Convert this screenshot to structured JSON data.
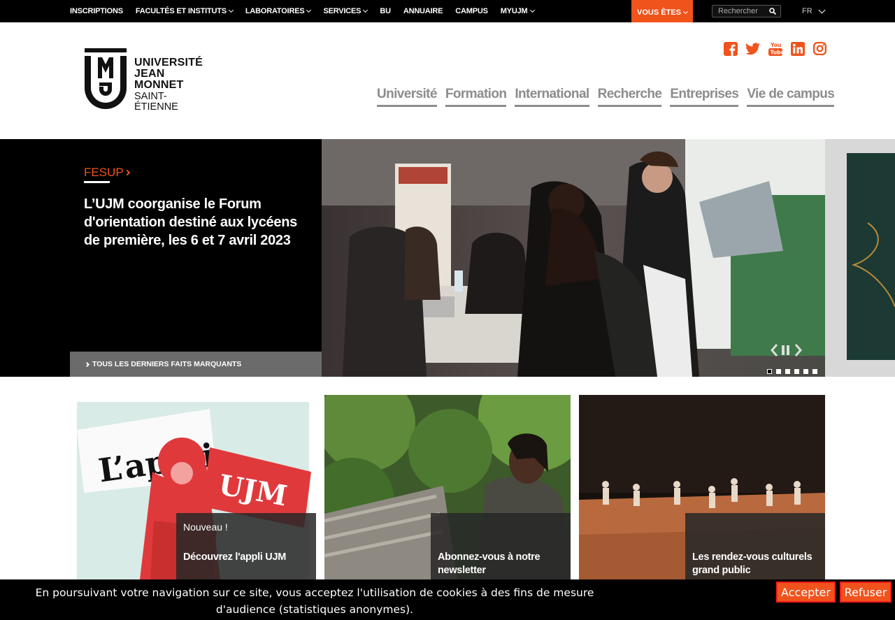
{
  "topbar": {
    "items": [
      {
        "label": "INSCRIPTIONS",
        "dropdown": false
      },
      {
        "label": "FACULTÉS ET INSTITUTS",
        "dropdown": true
      },
      {
        "label": "LABORATOIRES",
        "dropdown": true
      },
      {
        "label": "SERVICES",
        "dropdown": true
      },
      {
        "label": "BU",
        "dropdown": false
      },
      {
        "label": "ANNUAIRE",
        "dropdown": false
      },
      {
        "label": "CAMPUS",
        "dropdown": false
      },
      {
        "label": "MYUJM",
        "dropdown": true
      }
    ],
    "vous_etes": "VOUS ÊTES",
    "search_placeholder": "Rechercher",
    "language": "FR"
  },
  "logo": {
    "line1": "UNIVERSITÉ",
    "line2": "JEAN MONNET",
    "line3": "SAINT-ÉTIENNE"
  },
  "social_icons": [
    "facebook-icon",
    "twitter-icon",
    "youtube-icon",
    "linkedin-icon",
    "instagram-icon"
  ],
  "mainnav": [
    "Université",
    "Formation",
    "International",
    "Recherche",
    "Entreprises",
    "Vie de campus"
  ],
  "hero": {
    "category": "FESUP",
    "title": "L’UJM coorganise le Forum d'orientation destiné aux lycéens de première, les 6 et 7 avril 2023",
    "all_link": "TOUS LES DERNIERS FAITS MARQUANTS",
    "slide_count": 6,
    "active_slide": 0
  },
  "tiles": [
    {
      "kicker": "Nouveau !",
      "title": "Découvrez l'appli UJM",
      "image_text_1": "L’appli",
      "image_text_2": "UJM"
    },
    {
      "kicker": "",
      "title": "Abonnez-vous à notre newsletter"
    },
    {
      "kicker": "",
      "title": "Les rendez-vous culturels grand public"
    }
  ],
  "cookie": {
    "text": "En poursuivant votre navigation sur ce site, vous acceptez l'utilisation de cookies à des fins de mesure d'audience (statistiques anonymes).",
    "accept": "Accepter",
    "refuse": "Refuser"
  },
  "colors": {
    "accent": "#f0531c",
    "nav_grey": "#8c8c8c"
  }
}
